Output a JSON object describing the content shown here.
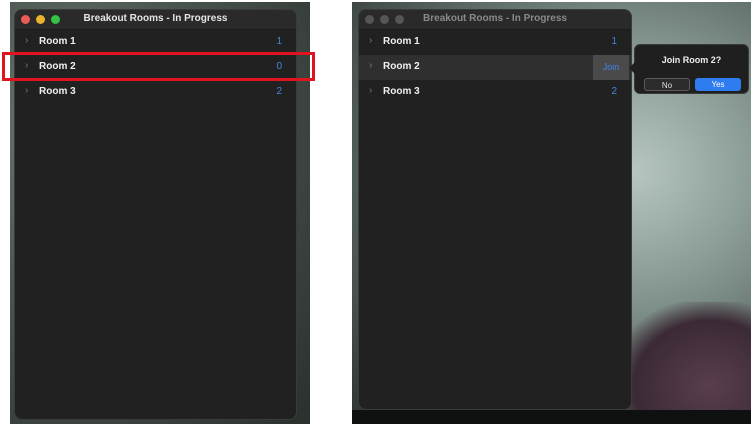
{
  "window_title": "Breakout Rooms - In Progress",
  "rooms": [
    {
      "name": "Room 1",
      "count": "1"
    },
    {
      "name": "Room 2",
      "count": "0"
    },
    {
      "name": "Room 3",
      "count": "2"
    }
  ],
  "rooms_right": [
    {
      "name": "Room 1",
      "count": "1"
    },
    {
      "name": "Room 2",
      "count": ""
    },
    {
      "name": "Room 3",
      "count": "2"
    }
  ],
  "join_label": "Join",
  "confirm": {
    "title": "Join Room 2?",
    "no_label": "No",
    "yes_label": "Yes"
  },
  "colors": {
    "accent": "#3e86e8",
    "highlight": "#e0141e",
    "close": "#ee5b55",
    "minimize": "#e9b32e",
    "zoom": "#34c344"
  },
  "icons": {
    "chevron": "chevron-right-icon"
  }
}
